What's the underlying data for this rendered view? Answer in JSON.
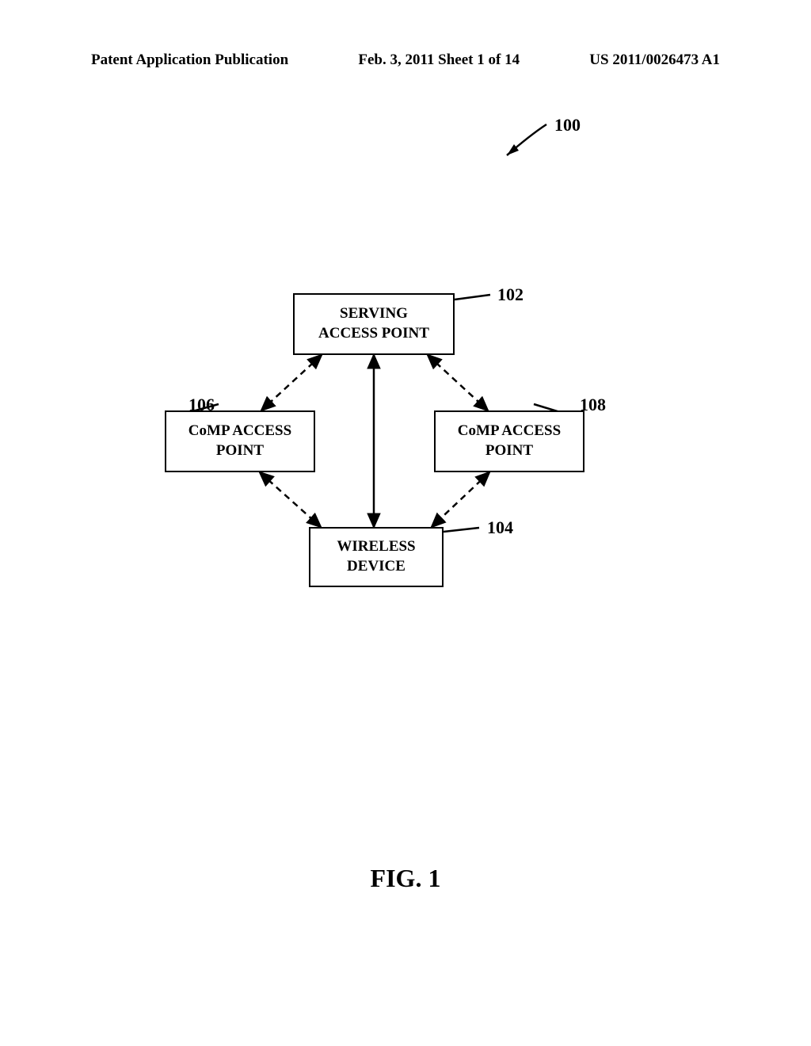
{
  "header": {
    "left": "Patent Application Publication",
    "center": "Feb. 3, 2011  Sheet 1 of 14",
    "right": "US 2011/0026473 A1"
  },
  "refs": {
    "system": "100",
    "serving": "102",
    "wireless": "104",
    "comp_left": "106",
    "comp_right": "108"
  },
  "boxes": {
    "serving_line1": "SERVING",
    "serving_line2": "ACCESS POINT",
    "comp_line1": "CoMP ACCESS",
    "comp_line2": "POINT",
    "wireless_line1": "WIRELESS",
    "wireless_line2": "DEVICE"
  },
  "caption": "FIG. 1"
}
